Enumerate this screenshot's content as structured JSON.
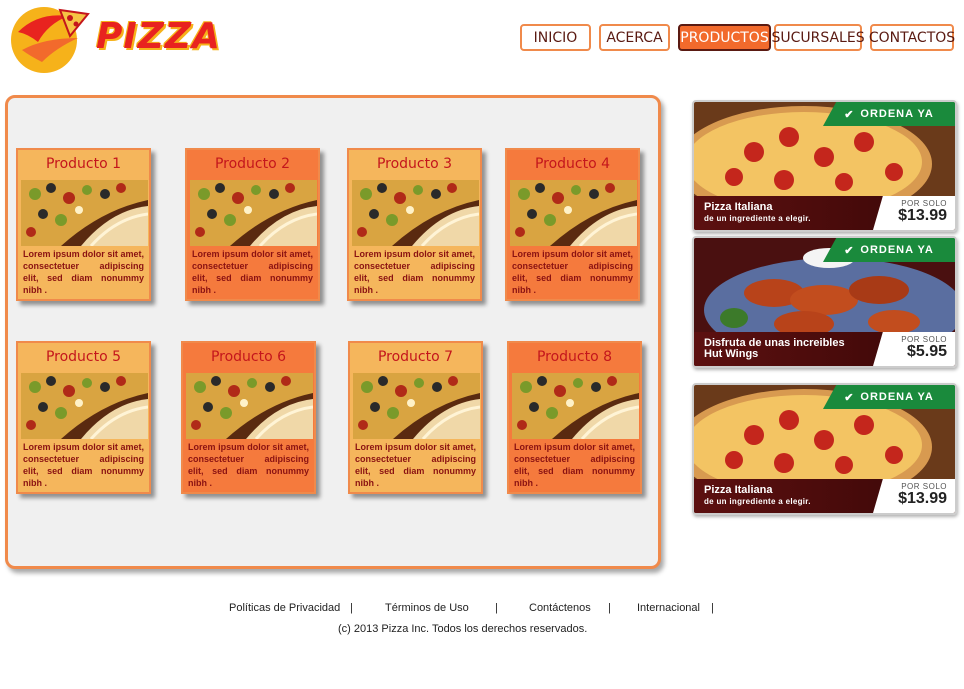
{
  "brand": {
    "logo_text": "PIZZA"
  },
  "nav": {
    "items": [
      {
        "label": "INICIO",
        "active": false
      },
      {
        "label": "ACERCA",
        "active": false
      },
      {
        "label": "PRODUCTOS",
        "active": true
      },
      {
        "label": "SUCURSALES",
        "active": false
      },
      {
        "label": "CONTACTOS",
        "active": false
      }
    ]
  },
  "products": [
    {
      "title": "Producto 1",
      "text": "Lorem ipsum dolor sit amet, consectetuer adipiscing elit, sed diam nonummy nibh .",
      "style": "tan"
    },
    {
      "title": "Producto 2",
      "text": "Lorem ipsum dolor sit amet, consectetuer adipiscing elit, sed diam nonummy nibh .",
      "style": "orange"
    },
    {
      "title": "Producto 3",
      "text": "Lorem ipsum dolor sit amet, consectetuer adipiscing elit, sed diam nonummy nibh .",
      "style": "tan"
    },
    {
      "title": "Producto 4",
      "text": "Lorem ipsum dolor sit amet, consectetuer adipiscing elit, sed diam nonummy nibh .",
      "style": "orange"
    },
    {
      "title": "Producto 5",
      "text": "Lorem ipsum dolor sit amet, consectetuer adipiscing elit, sed diam nonummy nibh .",
      "style": "tan"
    },
    {
      "title": "Producto 6",
      "text": "Lorem ipsum dolor sit amet, consectetuer adipiscing elit, sed diam nonummy nibh .",
      "style": "orange"
    },
    {
      "title": "Producto 7",
      "text": "Lorem ipsum dolor sit amet, consectetuer adipiscing elit, sed diam nonummy nibh .",
      "style": "tan"
    },
    {
      "title": "Producto 8",
      "text": "Lorem ipsum dolor sit amet, consectetuer adipiscing elit, sed diam nonummy nibh .",
      "style": "orange"
    }
  ],
  "ads": [
    {
      "order_label": "ORDENA YA",
      "name": "Pizza Italiana",
      "sub": "de un ingrediente a elegir.",
      "por_solo": "POR SOLO",
      "price": "$13.99",
      "kind": "pizza"
    },
    {
      "order_label": "ORDENA YA",
      "name": "Disfruta de unas increibles",
      "sub": "Hut Wings",
      "por_solo": "POR SOLO",
      "price": "$5.95",
      "kind": "wings"
    },
    {
      "order_label": "ORDENA YA",
      "name": "Pizza Italiana",
      "sub": "de un ingrediente a elegir.",
      "por_solo": "POR SOLO",
      "price": "$13.99",
      "kind": "pizza"
    }
  ],
  "footer": {
    "links": [
      "Políticas de Privacidad",
      "Términos de Uso",
      "Contáctenos",
      "Internacional"
    ],
    "separator": "|",
    "copyright": "(c) 2013 Pizza Inc. Todos los derechos reservados."
  },
  "colors": {
    "accent": "#f08a4b",
    "nav_active": "#f26a2c",
    "card_tan": "#f5b65c",
    "card_orange": "#f57a3d",
    "title_red": "#c4161c",
    "order_green": "#1a8a3c"
  }
}
